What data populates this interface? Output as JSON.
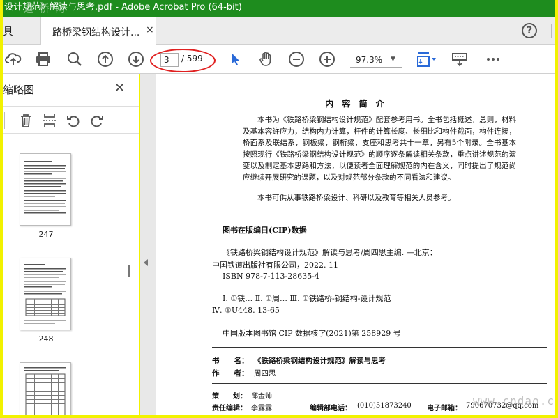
{
  "window": {
    "title": "设计规范》解读与思考.pdf - Adobe Acrobat Pro (64-bit)",
    "watermark": "道 桥 网"
  },
  "tabbar": {
    "left_label": "具",
    "tab_label": "路桥梁钢结构设计...",
    "close_glyph": "×",
    "help_glyph": "?"
  },
  "toolbar": {
    "current_page": "3",
    "total_pages": "/ 599",
    "zoom": "97.3%"
  },
  "sidebar": {
    "title": "缩略图",
    "thumbnails": [
      {
        "label": "247"
      },
      {
        "label": "248"
      }
    ]
  },
  "document": {
    "summary_heading": "内 容 简 介",
    "summary_p1": "本书为《铁路桥梁钢结构设计规范》配套参考用书。全书包括概述，总则，材料及基本容许应力，结构内力计算，杆件的计算长度、长细比和构件截面，构件连接，桥面系及联结系，钢板梁，钢桁梁，支座和思考共十一章，另有5个附录。全书基本按照现行《铁路桥梁钢结构设计规范》的顺序逐条解读相关条款，重点讲述规范的演变以及制定基本思路和方法，以便读者全面理解规范的内在含义，同时提出了规范尚应继续开展研究的课题，以及对规范部分条款的不同看法和建议。",
    "summary_p2": "本书可供从事铁路桥梁设计、科研以及教育等相关人员参考。",
    "cip_heading": "图书在版编目(CIP)数据",
    "cip_line1": "《铁路桥梁钢结构设计规范》解读与思考/周四思主编. —北京：",
    "cip_line2": "中国铁道出版社有限公司，2022. 11",
    "cip_line3": "ISBN 978-7-113-28635-4",
    "cip_line4": "Ⅰ. ①铁…   Ⅱ. ①周…   Ⅲ. ①铁路桥-钢结构-设计规范",
    "cip_line5": "Ⅳ. ①U448. 13-65",
    "cip_line6": "中国版本图书馆 CIP 数据核字(2021)第 258929 号",
    "book_name_label": "书　　名：",
    "book_name": "《铁路桥梁钢结构设计规范》解读与思考",
    "author_label": "作　　者：",
    "author": "周四思",
    "planner_label": "策　　划：",
    "planner": "邱金帅",
    "editor_label": "责任编辑：",
    "editor": "李露露",
    "phone_label": "编辑部电话：",
    "phone": "(010)51873240",
    "email_label": "电子邮箱：",
    "email": "790670732@qq.com",
    "watermark": "www.cndao.com"
  }
}
